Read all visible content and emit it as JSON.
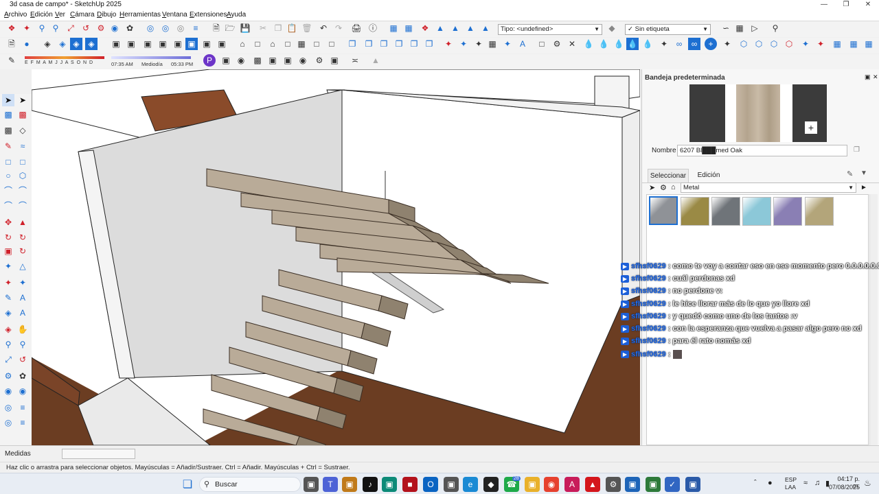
{
  "window": {
    "title": "3d casa de campo* - SketchUp 2025",
    "controls": [
      "minimize-icon",
      "restore-icon",
      "close-icon"
    ]
  },
  "menu": [
    "Archivo",
    "Edición",
    "Ver",
    "Cámara",
    "Dibujo",
    "Herramientas",
    "Ventana",
    "Extensiones",
    "Ayuda"
  ],
  "toolbar": {
    "type_combo": "Tipo: <undefined>",
    "tag_combo": "Sin etiqueta",
    "shadow_months": "E F M A M J J A S O N D",
    "shadow_time_start": "07:35 AM",
    "shadow_time_mid": "Mediodía",
    "shadow_time_end": "05:33 PM"
  },
  "tray": {
    "title": "Bandeja predeterminada",
    "name_label": "Nombre",
    "material_name": "6207 Bl███med Oak",
    "tab_select": "Seleccionar",
    "tab_edit": "Edición",
    "library": "Metal",
    "swatch_colors": [
      "#8f9297",
      "#9a8a45",
      "#6f7479",
      "#8cc8d8",
      "#8a7fb4",
      "#b3a57a"
    ]
  },
  "chat": {
    "username": "sfhsf0629",
    "messages": [
      "como te voy a contar eso en ese momento pero 0.0.0.0.0.0",
      "cuál perdonas xd",
      "no perdone v:",
      "le hice llorar más de lo que yo llore xd",
      "y quedó como uno de los tantos :v",
      "con la esperanza que vuelva a pasar algo pero no xd",
      "para él rato nomás xd",
      ""
    ]
  },
  "measure": {
    "label": "Medidas",
    "value": ""
  },
  "status": {
    "hint": "Haz clic o arrastra para seleccionar objetos. Mayúsculas = Añadir/Sustraer. Ctrl = Añadir. Mayúsculas + Ctrl = Sustraer."
  },
  "taskbar": {
    "search_placeholder": "Buscar",
    "badge_count": "28",
    "lang": "ESP",
    "lang2": "LAA",
    "time": "04:17 p. m.",
    "date": "07/08/2025"
  },
  "colors": {
    "floor": "#6b3d22",
    "stair": "#b9ab98",
    "wall": "#ffffff",
    "selected": "#1d6fd1"
  }
}
